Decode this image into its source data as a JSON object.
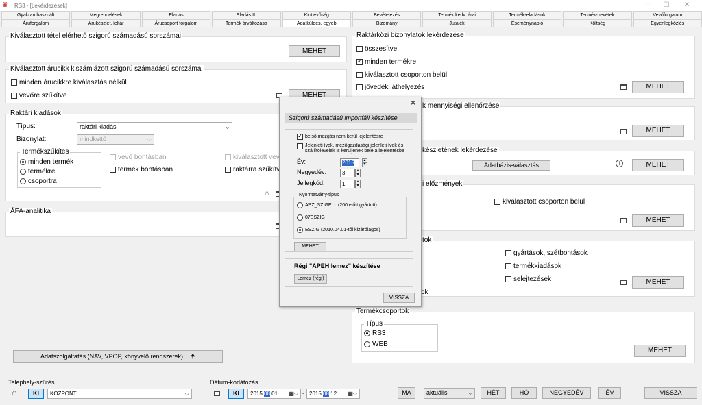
{
  "window": {
    "title": "RS3 - [Lekérdezések]",
    "controls": [
      "—",
      "☐",
      "✕"
    ]
  },
  "tabs_row1": [
    "Gyakran használt",
    "Megrendelések",
    "Eladás",
    "Eladás II.",
    "Kintlévőség",
    "Bevételezés",
    "Termék kedv. árai",
    "Termék-eladások",
    "Termék-bevétek",
    "Vevőforgalom"
  ],
  "tabs_row2": [
    "Áruforgalom",
    "Árukészlet, leltár",
    "Árucsoport forgalom",
    "Termék árváltozása",
    "Adatküldés, egyéb",
    "Bizomány",
    "Jutalék",
    "Eseménynapló",
    "Költség",
    "Egyenlegközlés"
  ],
  "left": {
    "p1": {
      "title": "Kiválasztott tétel elérhető szigorú számadású sorszámai",
      "button": "MEHET"
    },
    "p2": {
      "title": "Kiválasztott árucikk kiszámlázott szigorú számadású sorszámai",
      "cb1": "minden árucikkre kiválasztás nélkül",
      "cb2": "vevőre szűkítve",
      "button": "MEHET"
    },
    "p3": {
      "title": "Raktári kiadások",
      "tipus_label": "Típus:",
      "tipus_value": "raktári kiadás",
      "bizonylat_label": "Bizonylat:",
      "bizonylat_value": "mindkettő",
      "group_title": "Termékszűkítés",
      "radios": [
        "minden termék",
        "termékre",
        "csoportra"
      ],
      "cb_vevo": "vevő bontásban",
      "cb_termek": "termék bontásban",
      "cb_kival": "kiválasztott vevő",
      "cb_raktar": "raktárra szűkítve"
    },
    "p4": {
      "title": "ÁFA-analitika"
    },
    "adatszolg": "Adatszolgáltatás (NAV, VPOP, könyvelő rendszerek)"
  },
  "right": {
    "p1": {
      "title": "Raktárközi bizonylatok lekérdezése",
      "cbs": [
        "összesítve",
        "minden termékre",
        "kiválasztott csoporton belül",
        "jövedéki áthelyezés"
      ],
      "button": "MEHET"
    },
    "p2": {
      "title": "k mennyiségi ellenőrzése",
      "button": "MEHET"
    },
    "p3": {
      "title": "készletének lekérdezése",
      "db_button": "Adatbázis-választás",
      "button": "MEHET"
    },
    "p4": {
      "title": "i előzmények",
      "cb": "kiválasztott csoporton belül",
      "button": "MEHET"
    },
    "p5": {
      "title": "tok",
      "cbs": [
        "gyártások, szétbontások",
        "termékkiadások",
        "selejtezések"
      ],
      "extra": "ok",
      "button": "MEHET"
    },
    "p6": {
      "title": "Termékcsoportok",
      "group_title": "Típus",
      "radios": [
        "RS3",
        "WEB"
      ],
      "button": "MEHET"
    }
  },
  "dialog": {
    "close": "×",
    "title": "Szigorú számadású importfájl készítése",
    "cb1": "belső mozgás nem kerül lejelentésre",
    "cb2_line1": "Jelenléti ívek, mezőgazdasági jelenléti ívek és",
    "cb2_line2": "szállítólevelek is kerüljenek bele a lejelentésbe",
    "ev_label": "Év:",
    "ev_value": "2015",
    "negyedev_label": "Negyedév:",
    "negyedev_value": "3",
    "jelleg_label": "Jellegkód:",
    "jelleg_value": "1",
    "nyomtatvany_title": "Nyomtatvány-típus",
    "radios": [
      "ASZ_SZIGELL (200 előtt gyártott)",
      "07ESZIG",
      "ESZIG (2010.04.01-től kizárólagos)"
    ],
    "mehet": "MEHET",
    "apeh_title": "Régi \"APEH lemez\" készítése",
    "lemez": "Lemez (régi)",
    "vissza": "VISSZA"
  },
  "bottom": {
    "telephely_label": "Telephely-szűrés",
    "ki": "KI",
    "kozpont": "KÖZPONT",
    "datum_label": "Dátum-korlátozás",
    "date_from_pre": "2015.",
    "date_from_hl": "08",
    "date_from_post": ".01.",
    "dash": "-",
    "date_to_pre": "2015.",
    "date_to_hl": "08",
    "date_to_post": ".12.",
    "ma": "MA",
    "aktualis": "aktuális",
    "het": "HÉT",
    "ho": "HÓ",
    "negyedev": "NEGYEDÉV",
    "ev": "ÉV",
    "vissza": "VISSZA"
  }
}
